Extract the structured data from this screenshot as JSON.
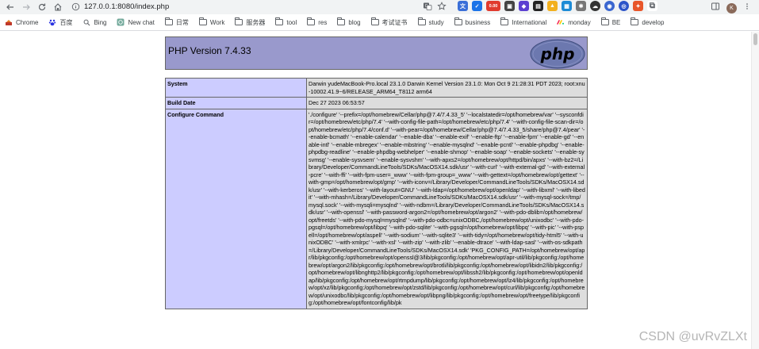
{
  "browser": {
    "url": "127.0.0.1:8080/index.php",
    "extensions": [
      "translate-icon",
      "puzzle-ext-icon",
      "red-badge-icon",
      "ext-4-icon",
      "ext-5-icon",
      "ext-6-icon",
      "ext-7-icon",
      "ext-8-icon",
      "ext-9-icon",
      "ext-10-icon",
      "ext-11-icon",
      "ext-12-icon",
      "ext-13-icon"
    ],
    "red_badge_text": "0.00",
    "avatar_letter": "K"
  },
  "bookmarks": [
    {
      "label": "Chrome",
      "icon": "chrome-icon"
    },
    {
      "label": "百度",
      "icon": "baidu-icon"
    },
    {
      "label": "Bing",
      "icon": "search-icon"
    },
    {
      "label": "New chat",
      "icon": "chat-icon"
    },
    {
      "label": "日常",
      "icon": "folder-icon"
    },
    {
      "label": "Work",
      "icon": "folder-icon"
    },
    {
      "label": "服务器",
      "icon": "folder-icon"
    },
    {
      "label": "tool",
      "icon": "folder-icon"
    },
    {
      "label": "res",
      "icon": "folder-icon"
    },
    {
      "label": "blog",
      "icon": "folder-icon"
    },
    {
      "label": "考试证书",
      "icon": "folder-icon"
    },
    {
      "label": "study",
      "icon": "folder-icon"
    },
    {
      "label": "business",
      "icon": "folder-icon"
    },
    {
      "label": "International",
      "icon": "folder-icon"
    },
    {
      "label": "monday",
      "icon": "monday-icon"
    },
    {
      "label": "BE",
      "icon": "folder-icon"
    },
    {
      "label": "develop",
      "icon": "folder-icon"
    }
  ],
  "phpinfo": {
    "title": "PHP Version 7.4.33",
    "logo_text": "php",
    "rows": [
      {
        "key": "System",
        "value": "Darwin yudeMacBook-Pro.local 23.1.0 Darwin Kernel Version 23.1.0: Mon Oct 9 21:28:31 PDT 2023; root:xnu-10002.41.9~6/RELEASE_ARM64_T8112 arm64"
      },
      {
        "key": "Build Date",
        "value": "Dec 27 2023 06:53:57"
      },
      {
        "key": "Configure Command",
        "value": "'./configure' '--prefix=/opt/homebrew/Cellar/php@7.4/7.4.33_5' '--localstatedir=/opt/homebrew/var' '--sysconfdir=/opt/homebrew/etc/php/7.4' '--with-config-file-path=/opt/homebrew/etc/php/7.4' '--with-config-file-scan-dir=/opt/homebrew/etc/php/7.4/conf.d' '--with-pear=/opt/homebrew/Cellar/php@7.4/7.4.33_5/share/php@7.4/pear' '--enable-bcmath' '--enable-calendar' '--enable-dba' '--enable-exif' '--enable-ftp' '--enable-fpm' '--enable-gd' '--enable-intl' '--enable-mbregex' '--enable-mbstring' '--enable-mysqlnd' '--enable-pcntl' '--enable-phpdbg' '--enable-phpdbg-readline' '--enable-phpdbg-webhelper' '--enable-shmop' '--enable-soap' '--enable-sockets' '--enable-sysvmsg' '--enable-sysvsem' '--enable-sysvshm' '--with-apxs2=/opt/homebrew/opt/httpd/bin/apxs' '--with-bz2=/Library/Developer/CommandLineTools/SDKs/MacOSX14.sdk/usr' '--with-curl' '--with-external-gd' '--with-external-pcre' '--with-ffi' '--with-fpm-user=_www' '--with-fpm-group=_www' '--with-gettext=/opt/homebrew/opt/gettext' '--with-gmp=/opt/homebrew/opt/gmp' '--with-iconv=/Library/Developer/CommandLineTools/SDKs/MacOSX14.sdk/usr' '--with-kerberos' '--with-layout=GNU' '--with-ldap=/opt/homebrew/opt/openldap' '--with-libxml' '--with-libedit' '--with-mhash=/Library/Developer/CommandLineTools/SDKs/MacOSX14.sdk/usr' '--with-mysql-sock=/tmp/mysql.sock' '--with-mysqli=mysqlnd' '--with-ndbm=/Library/Developer/CommandLineTools/SDKs/MacOSX14.sdk/usr' '--with-openssl' '--with-password-argon2=/opt/homebrew/opt/argon2' '--with-pdo-dblib=/opt/homebrew/opt/freetds' '--with-pdo-mysql=mysqlnd' '--with-pdo-odbc=unixODBC,/opt/homebrew/opt/unixodbc' '--with-pdo-pgsql=/opt/homebrew/opt/libpq' '--with-pdo-sqlite' '--with-pgsql=/opt/homebrew/opt/libpq' '--with-pic' '--with-pspell=/opt/homebrew/opt/aspell' '--with-sodium' '--with-sqlite3' '--with-tidy=/opt/homebrew/opt/tidy-html5' '--with-unixODBC' '--with-xmlrpc' '--with-xsl' '--with-zip' '--with-zlib' '--enable-dtrace' '--with-ldap-sasl' '--with-os-sdkpath=/Library/Developer/CommandLineTools/SDKs/MacOSX14.sdk' 'PKG_CONFIG_PATH=/opt/homebrew/opt/apr/lib/pkgconfig:/opt/homebrew/opt/openssl@3/lib/pkgconfig:/opt/homebrew/opt/apr-util/lib/pkgconfig:/opt/homebrew/opt/argon2/lib/pkgconfig:/opt/homebrew/opt/brotli/lib/pkgconfig:/opt/homebrew/opt/libidn2/lib/pkgconfig:/opt/homebrew/opt/libnghttp2/lib/pkgconfig:/opt/homebrew/opt/libssh2/lib/pkgconfig:/opt/homebrew/opt/openldap/lib/pkgconfig:/opt/homebrew/opt/rtmpdump/lib/pkgconfig:/opt/homebrew/opt/lz4/lib/pkgconfig:/opt/homebrew/opt/xz/lib/pkgconfig:/opt/homebrew/opt/zstd/lib/pkgconfig:/opt/homebrew/opt/curl/lib/pkgconfig:/opt/homebrew/opt/unixodbc/lib/pkgconfig:/opt/homebrew/opt/libpng/lib/pkgconfig:/opt/homebrew/opt/freetype/lib/pkgconfig:/opt/homebrew/opt/fontconfig/lib/pk"
      }
    ]
  },
  "watermark": "CSDN @uvRvZLXt",
  "colors": {
    "header_bg": "#9999cc",
    "key_bg": "#ccccff",
    "value_bg": "#dddddd",
    "border": "#666666",
    "logo_bg": "#6c78af"
  }
}
